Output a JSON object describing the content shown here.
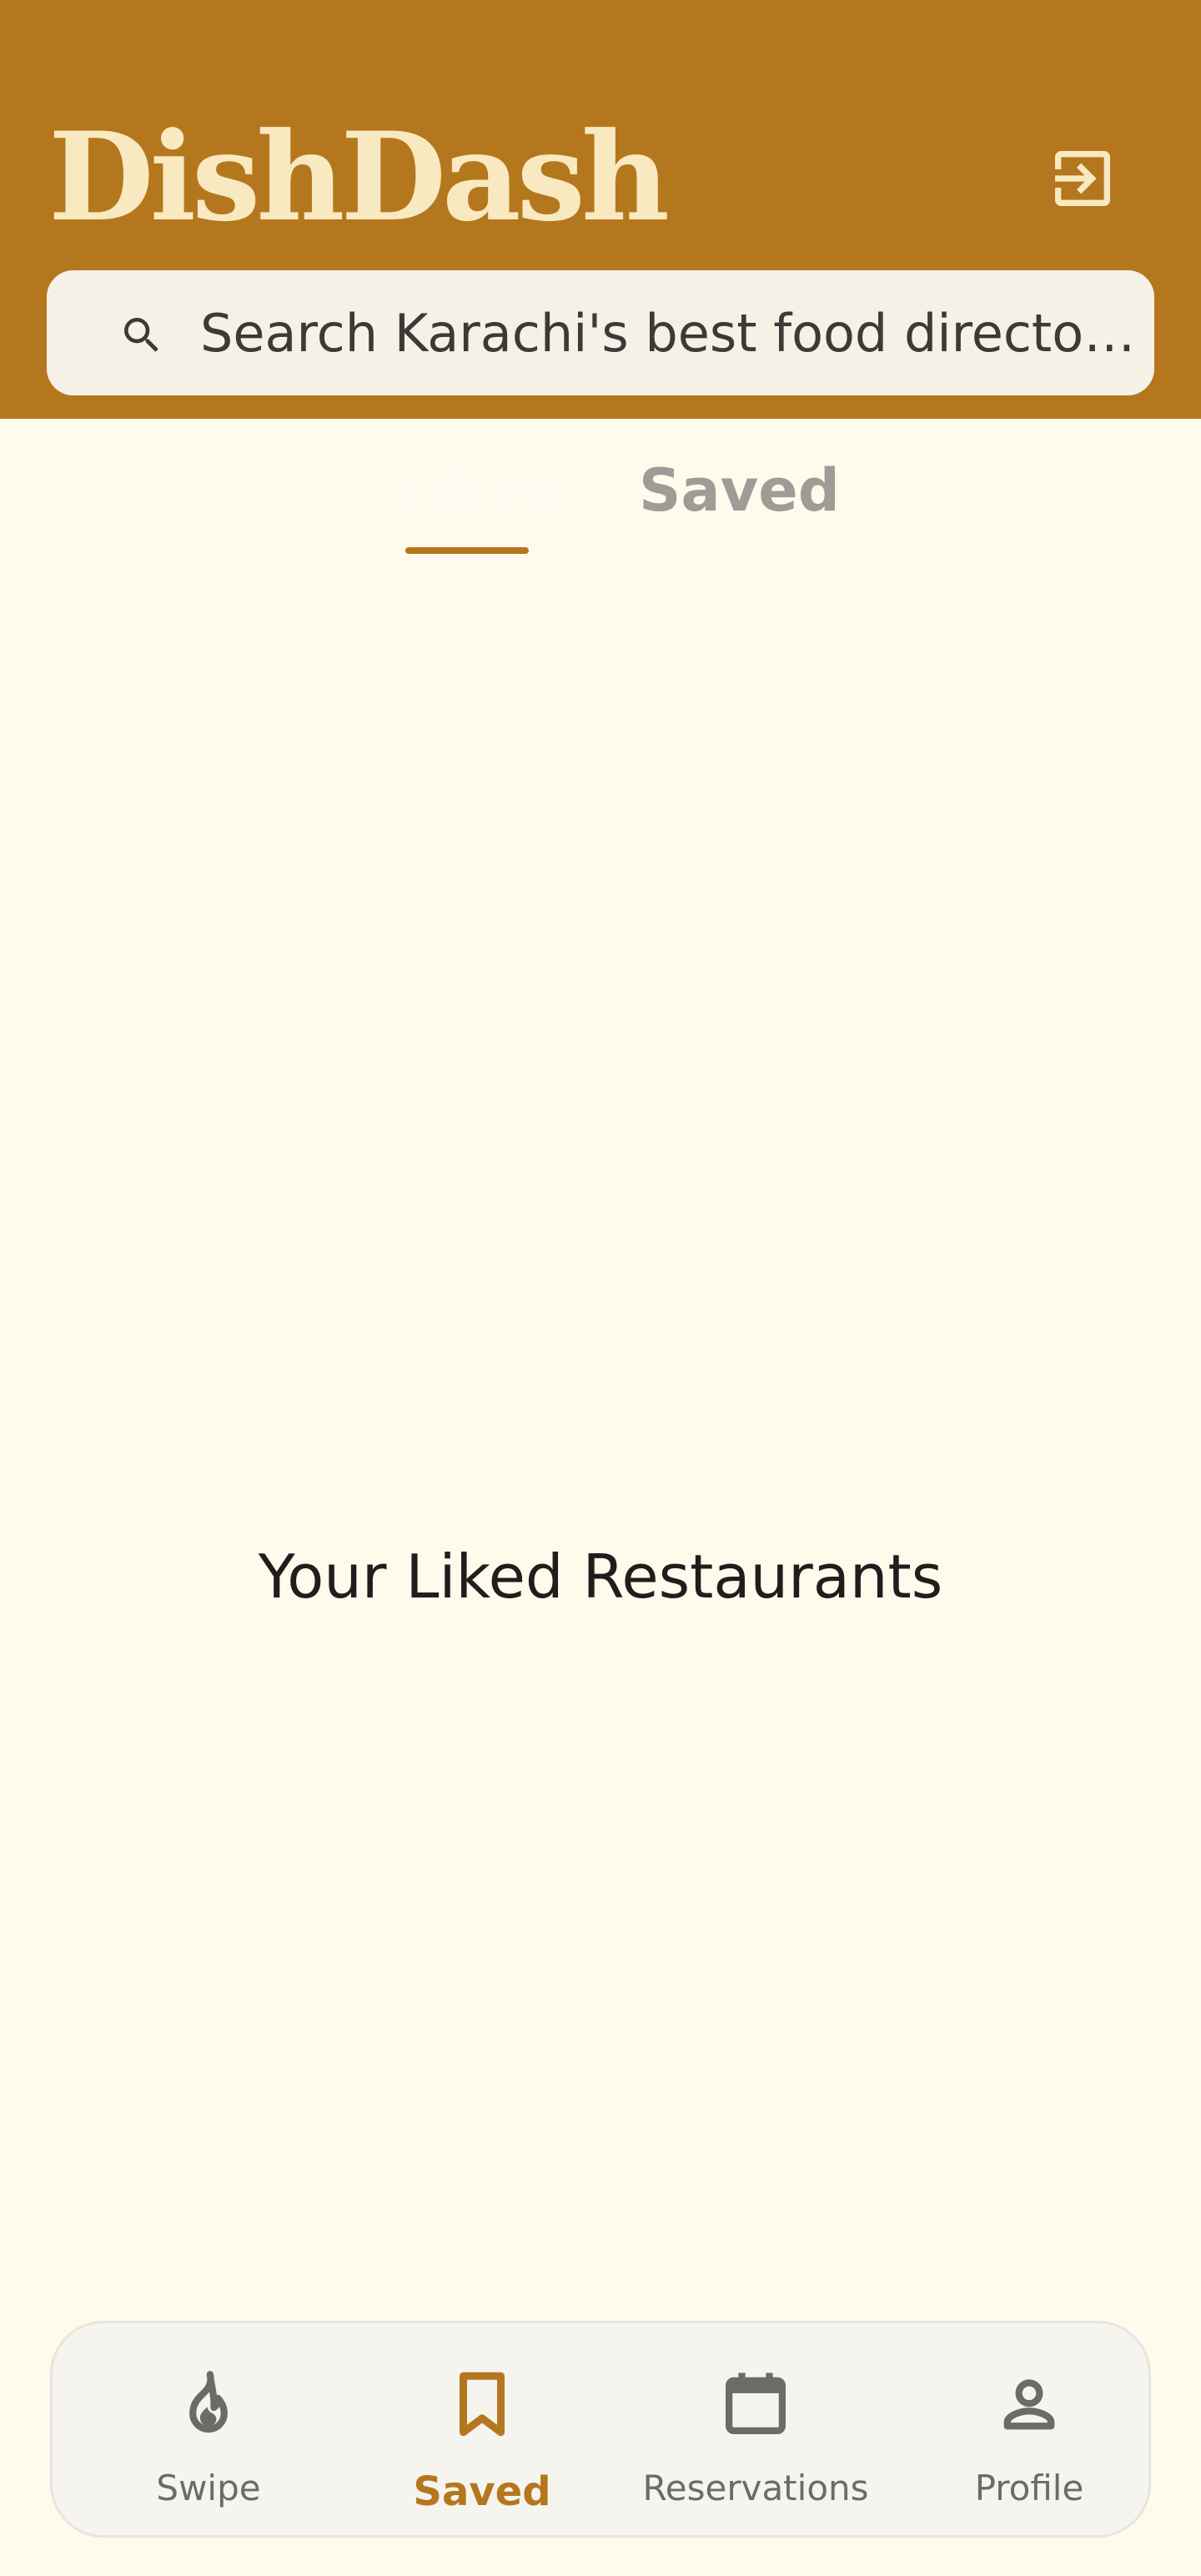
{
  "app": {
    "title": "DishDash"
  },
  "header": {
    "logout_icon": "logout-icon"
  },
  "search": {
    "placeholder": "Search Karachi's best food directory...",
    "value": "",
    "icon": "search-icon"
  },
  "tabs": [
    {
      "label": "Liked",
      "active": true
    },
    {
      "label": "Saved",
      "active": false
    }
  ],
  "main": {
    "empty_title": "Your Liked Restaurants"
  },
  "bottom_nav": {
    "items": [
      {
        "label": "Swipe",
        "icon": "flame-icon",
        "active": false
      },
      {
        "label": "Saved",
        "icon": "bookmark-icon",
        "active": true
      },
      {
        "label": "Reservations",
        "icon": "calendar-icon",
        "active": false
      },
      {
        "label": "Profile",
        "icon": "person-icon",
        "active": false
      }
    ]
  },
  "colors": {
    "header_background": "#b5771e",
    "title_text": "#f8e9c0",
    "page_background": "#fefbec",
    "accent": "#b5771e",
    "inactive_tab": "#9e9c97",
    "inactive_nav": "#6d6b66"
  }
}
